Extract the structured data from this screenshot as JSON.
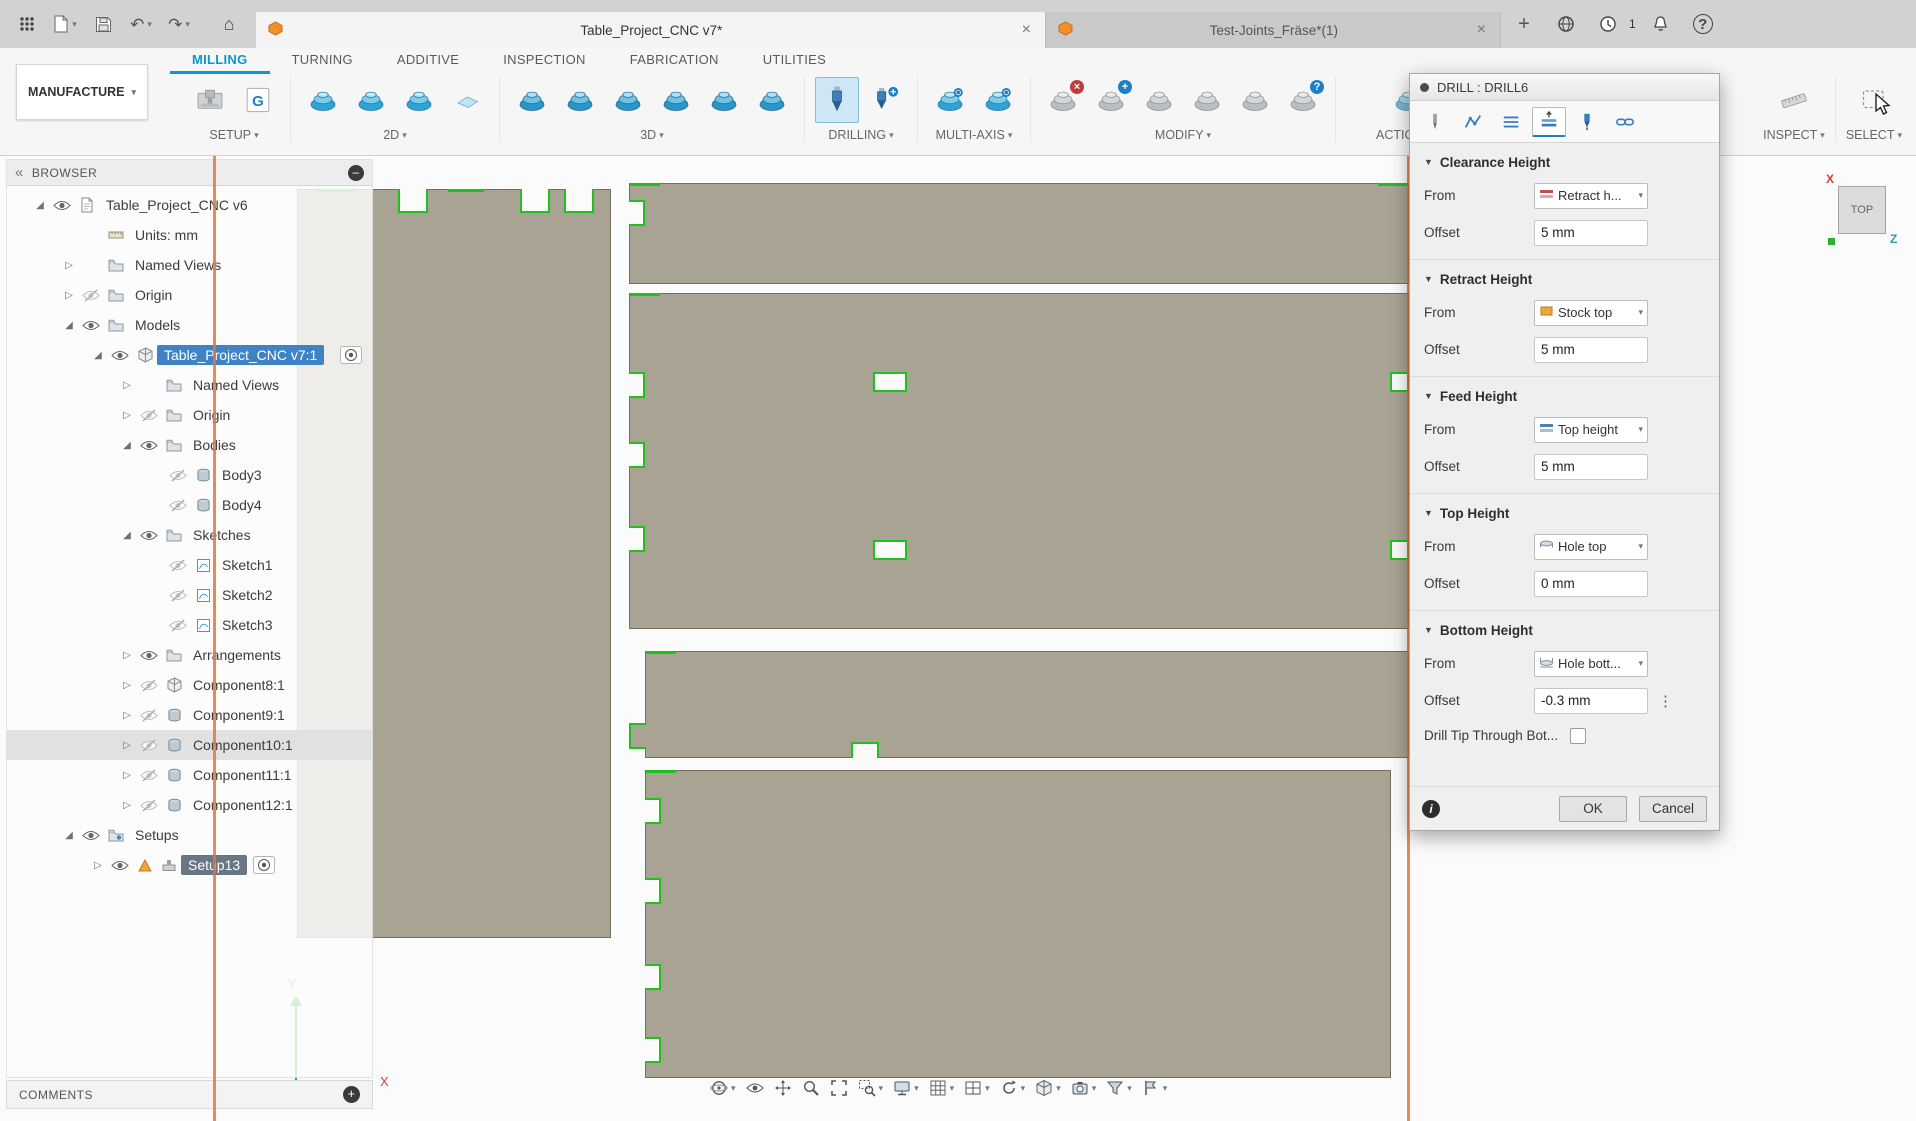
{
  "titlebar": {
    "left_icons": [
      {
        "name": "app-grid-icon",
        "caret": false
      },
      {
        "name": "file-menu-icon",
        "caret": true
      },
      {
        "name": "save-icon",
        "caret": false
      },
      {
        "name": "undo-icon",
        "caret": true
      },
      {
        "name": "redo-icon",
        "caret": true
      }
    ],
    "tabs": [
      {
        "label": "Table_Project_CNC v7*",
        "active": true
      },
      {
        "label": "Test-Joints_Fräse*(1)",
        "active": false
      }
    ],
    "right_icons": [
      {
        "name": "new-tab-icon",
        "badge": ""
      },
      {
        "name": "extensions-icon",
        "badge": ""
      },
      {
        "name": "job-status-icon",
        "badge": "1"
      },
      {
        "name": "notifications-icon",
        "badge": ""
      },
      {
        "name": "help-icon",
        "badge": ""
      }
    ]
  },
  "ribbon": {
    "workspace_label": "MANUFACTURE",
    "tabs": [
      {
        "label": "MILLING",
        "active": true
      },
      {
        "label": "TURNING",
        "active": false
      },
      {
        "label": "ADDITIVE",
        "active": false
      },
      {
        "label": "INSPECTION",
        "active": false
      },
      {
        "label": "FABRICATION",
        "active": false
      },
      {
        "label": "UTILITIES",
        "active": false
      }
    ],
    "groups": [
      {
        "label": "SETUP",
        "icons": [
          {
            "name": "machine-icon"
          },
          {
            "name": "gcode-icon"
          }
        ]
      },
      {
        "label": "2D",
        "icons": [
          {
            "name": "toolpath-2d-icon"
          },
          {
            "name": "toolpath-2d-icon"
          },
          {
            "name": "toolpath-2d-icon"
          },
          {
            "name": "face-icon"
          }
        ]
      },
      {
        "label": "3D",
        "icons": [
          {
            "name": "toolpath-3d-icon"
          },
          {
            "name": "toolpath-3d-icon"
          },
          {
            "name": "toolpath-3d-icon"
          },
          {
            "name": "toolpath-3d-icon"
          },
          {
            "name": "toolpath-3d-icon"
          },
          {
            "name": "toolpath-3d-icon"
          }
        ]
      },
      {
        "label": "DRILLING",
        "icons": [
          {
            "name": "drill-icon",
            "active": true
          },
          {
            "name": "drill-add-icon"
          }
        ]
      },
      {
        "label": "MULTI-AXIS",
        "icons": [
          {
            "name": "multiaxis-icon"
          },
          {
            "name": "multiaxis-icon"
          }
        ]
      },
      {
        "label": "MODIFY",
        "icons": [
          {
            "name": "modify-icon",
            "badge": "x"
          },
          {
            "name": "modify-icon",
            "badge": "plus"
          },
          {
            "name": "modify-icon"
          },
          {
            "name": "modify-icon"
          },
          {
            "name": "modify-icon"
          },
          {
            "name": "modify-icon",
            "badge": "q"
          }
        ]
      },
      {
        "label": "ACTIONS",
        "icons": [
          {
            "name": "action-icon"
          }
        ],
        "actions": true
      },
      {
        "label": "INSPECT",
        "icons": [
          {
            "name": "measure-icon"
          }
        ],
        "right": true
      },
      {
        "label": "SELECT",
        "icons": [
          {
            "name": "select-icon"
          }
        ]
      }
    ]
  },
  "browser": {
    "title": "BROWSER",
    "comments_label": "COMMENTS",
    "tree": [
      {
        "depth": 0,
        "arrow": "open",
        "eye": "on",
        "icon": "doc-icon",
        "label": "Table_Project_CNC v6"
      },
      {
        "depth": 1,
        "arrow": "none",
        "eye": "none",
        "icon": "ruler-icon",
        "label": "Units: mm"
      },
      {
        "depth": 1,
        "arrow": "closed",
        "eye": "none",
        "icon": "folder-icon",
        "label": "Named Views"
      },
      {
        "depth": 1,
        "arrow": "closed",
        "eye": "off",
        "icon": "folder-icon",
        "label": "Origin"
      },
      {
        "depth": 1,
        "arrow": "open",
        "eye": "on",
        "icon": "folder-icon",
        "label": "Models"
      },
      {
        "depth": 2,
        "arrow": "open",
        "eye": "on",
        "icon": "component-icon",
        "label": "Table_Project_CNC v7:1",
        "selected": "blue",
        "radio": "right"
      },
      {
        "depth": 3,
        "arrow": "closed",
        "eye": "none",
        "icon": "folder-icon",
        "label": "Named Views"
      },
      {
        "depth": 3,
        "arrow": "closed",
        "eye": "off",
        "icon": "folder-icon",
        "label": "Origin"
      },
      {
        "depth": 3,
        "arrow": "open",
        "eye": "on",
        "icon": "folder-icon",
        "label": "Bodies"
      },
      {
        "depth": 4,
        "arrow": "none",
        "eye": "off",
        "icon": "body-icon",
        "label": "Body3"
      },
      {
        "depth": 4,
        "arrow": "none",
        "eye": "off",
        "icon": "body-icon",
        "label": "Body4"
      },
      {
        "depth": 3,
        "arrow": "open",
        "eye": "on",
        "icon": "folder-icon",
        "label": "Sketches"
      },
      {
        "depth": 4,
        "arrow": "none",
        "eye": "off",
        "icon": "sketch-icon",
        "label": "Sketch1"
      },
      {
        "depth": 4,
        "arrow": "none",
        "eye": "off",
        "icon": "sketch-icon",
        "label": "Sketch2"
      },
      {
        "depth": 4,
        "arrow": "none",
        "eye": "off",
        "icon": "sketch-icon",
        "label": "Sketch3"
      },
      {
        "depth": 3,
        "arrow": "closed",
        "eye": "on",
        "icon": "folder-icon",
        "label": "Arrangements"
      },
      {
        "depth": 3,
        "arrow": "closed",
        "eye": "off",
        "icon": "component-icon",
        "label": "Component8:1"
      },
      {
        "depth": 3,
        "arrow": "closed",
        "eye": "off",
        "icon": "body-icon",
        "label": "Component9:1"
      },
      {
        "depth": 3,
        "arrow": "closed",
        "eye": "off",
        "icon": "body-icon",
        "label": "Component10:1",
        "hover": true
      },
      {
        "depth": 3,
        "arrow": "closed",
        "eye": "off",
        "icon": "body-icon",
        "label": "Component11:1"
      },
      {
        "depth": 3,
        "arrow": "closed",
        "eye": "off",
        "icon": "body-icon",
        "label": "Component12:1"
      },
      {
        "depth": 1,
        "arrow": "open",
        "eye": "on",
        "icon": "setups-icon",
        "label": "Setups"
      },
      {
        "depth": 2,
        "arrow": "closed",
        "eye": "on",
        "icon": "setup-icon",
        "pre_icon": "warn-triangle-icon",
        "label": "Setup13",
        "selected": "dark",
        "radio": "inline"
      }
    ]
  },
  "viewport": {
    "viewcube_face": "TOP",
    "viewcube_x": "X",
    "viewcube_z": "Z",
    "axis_y": "Y",
    "axis_x": "X",
    "navbar": [
      {
        "name": "orbit-icon",
        "caret": true
      },
      {
        "name": "look-at-icon",
        "caret": false
      },
      {
        "name": "pan-icon",
        "caret": false
      },
      {
        "name": "zoom-icon",
        "caret": false
      },
      {
        "name": "fit-icon",
        "caret": false
      },
      {
        "name": "zoom-window-icon",
        "caret": true
      },
      {
        "name": "display-settings-icon",
        "caret": true
      },
      {
        "name": "grid-settings-icon",
        "caret": true
      },
      {
        "name": "viewports-icon",
        "caret": true
      },
      {
        "name": "refresh-icon",
        "caret": true
      },
      {
        "name": "visual-style-icon",
        "caret": true
      },
      {
        "name": "capture-icon",
        "caret": true
      },
      {
        "name": "selection-filter-icon",
        "caret": true
      },
      {
        "name": "marking-menu-icon",
        "caret": true
      }
    ],
    "colors": {
      "panel_fill": "#a8a392",
      "edge_highlight": "#1fc11f",
      "work_plane": "#e0763c"
    }
  },
  "dialog": {
    "title": "DRILL : DRILL6",
    "tabs": [
      {
        "name": "tool-tab-icon"
      },
      {
        "name": "geometry-tab-icon"
      },
      {
        "name": "passes-tab-icon"
      },
      {
        "name": "heights-tab-icon",
        "active": true
      },
      {
        "name": "cycle-tab-icon"
      },
      {
        "name": "linking-tab-icon"
      }
    ],
    "sections": [
      {
        "title": "Clearance Height",
        "from_label": "From",
        "from_value": "Retract h...",
        "from_icon": "retract-height-icon",
        "offset_label": "Offset",
        "offset_value": "5 mm"
      },
      {
        "title": "Retract Height",
        "from_label": "From",
        "from_value": "Stock top",
        "from_icon": "stock-top-icon",
        "offset_label": "Offset",
        "offset_value": "5 mm"
      },
      {
        "title": "Feed Height",
        "from_label": "From",
        "from_value": "Top height",
        "from_icon": "top-height-icon",
        "offset_label": "Offset",
        "offset_value": "5 mm"
      },
      {
        "title": "Top Height",
        "from_label": "From",
        "from_value": "Hole top",
        "from_icon": "hole-top-icon",
        "offset_label": "Offset",
        "offset_value": "0 mm"
      },
      {
        "title": "Bottom Height",
        "from_label": "From",
        "from_value": "Hole bott...",
        "from_icon": "hole-bottom-icon",
        "offset_label": "Offset",
        "offset_value": "-0.3 mm",
        "has_more": true,
        "checkbox_label": "Drill Tip Through Bot..."
      }
    ],
    "ok_label": "OK",
    "cancel_label": "Cancel"
  }
}
